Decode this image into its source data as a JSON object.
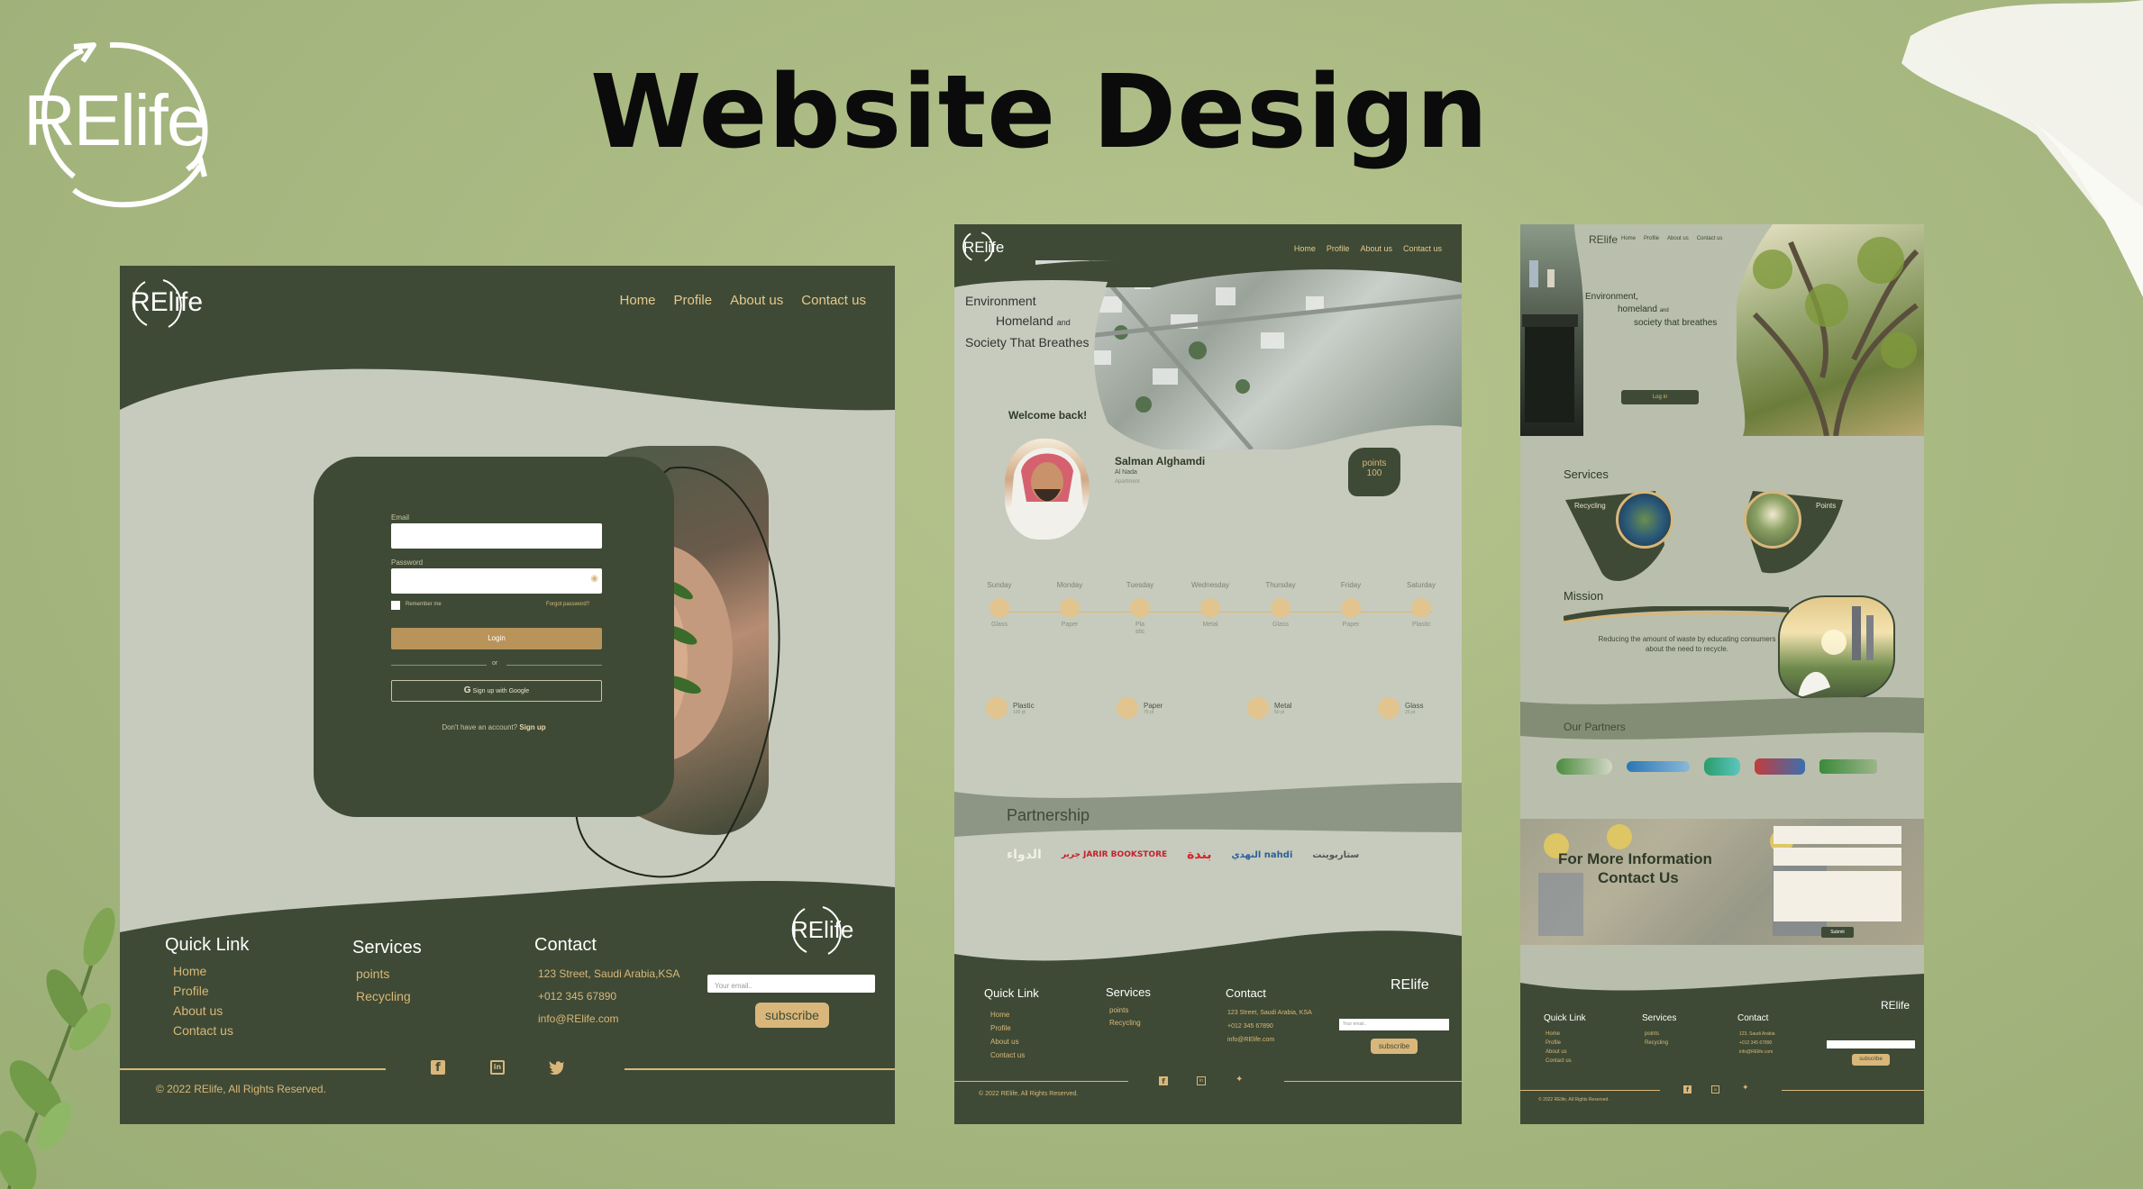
{
  "brand": {
    "logo_text": "RElife"
  },
  "headline": "Website Design",
  "login_page": {
    "logo": "RElife",
    "nav": [
      "Home",
      "Profile",
      "About us",
      "Contact us"
    ],
    "form": {
      "email_label": "Email",
      "password_label": "Password",
      "remember": "Remember me",
      "forgot": "Forgot password?",
      "login_button": "Login",
      "or": "or",
      "google_button": "Sign up with Google",
      "no_account": "Don't have an account?",
      "signup": "Sign up"
    },
    "footer": {
      "quick_link_title": "Quick Link",
      "quick_links": [
        "Home",
        "Profile",
        "About us",
        "Contact us"
      ],
      "services_title": "Services",
      "services": [
        "points",
        "Recycling"
      ],
      "contact_title": "Contact",
      "contact": [
        "123 Street, Saudi Arabia,KSA",
        "+012 345 67890",
        "info@RElife.com"
      ],
      "email_placeholder": "Your email..",
      "subscribe": "subscribe",
      "logo": "RElife",
      "copyright": "© 2022 RElife, All Rights Reserved."
    }
  },
  "profile_page": {
    "logo": "RElife",
    "nav": [
      "Home",
      "Profile",
      "About us",
      "Contact us"
    ],
    "hero_lines": [
      "Environment",
      "Homeland",
      "and",
      "Society That Breathes"
    ],
    "welcome": "Welcome back!",
    "user_name": "Salman Alghamdi",
    "user_sub1": "Al Nada",
    "user_sub2": "Apartment",
    "points_label": "points",
    "points_value": "100",
    "schedule": [
      {
        "day": "Sunday",
        "item": "Glass"
      },
      {
        "day": "Monday",
        "item": "Paper"
      },
      {
        "day": "Tuesday",
        "item": "Pla stic"
      },
      {
        "day": "Wednesday",
        "item": "Metal"
      },
      {
        "day": "Thursday",
        "item": "Glass"
      },
      {
        "day": "Friday",
        "item": "Paper"
      },
      {
        "day": "Saturday",
        "item": "Plastic"
      }
    ],
    "rates": [
      {
        "name": "Plastic",
        "value": "100 pt"
      },
      {
        "name": "Paper",
        "value": "75 pt"
      },
      {
        "name": "Metal",
        "value": "50 pt"
      },
      {
        "name": "Glass",
        "value": "25 pt"
      }
    ],
    "partnership_title": "Partnership",
    "partners": [
      "الدواء",
      "جرير JARIR BOOKSTORE",
      "بندة",
      "النهدي nahdi",
      "ستاربوينت"
    ],
    "footer": {
      "quick_link_title": "Quick Link",
      "quick_links": [
        "Home",
        "Profile",
        "About us",
        "Contact us"
      ],
      "services_title": "Services",
      "services": [
        "points",
        "Recycling"
      ],
      "contact_title": "Contact",
      "contact": [
        "123 Street, Saudi Arabia, KSA",
        "+012 345 67890",
        "info@RElife.com"
      ],
      "email_placeholder": "Your email..",
      "subscribe": "subscribe",
      "logo": "RElife",
      "copyright": "© 2022 RElife, All Rights Reserved."
    }
  },
  "home_page": {
    "logo": "RElife",
    "nav": [
      "Home",
      "Profile",
      "About us",
      "Contact us"
    ],
    "hero_lines": [
      "Environment,",
      "homeland",
      "and",
      "society that breathes"
    ],
    "login_button": "Log in",
    "services_title": "Services",
    "service_cards": [
      "Recycling",
      "Points"
    ],
    "mission_title": "Mission",
    "mission_text": "Reducing the amount of waste by educating consumers about the need to recycle.",
    "partners_title": "Our Partners",
    "contact_title_1": "For More Information",
    "contact_title_2": "Contact Us",
    "submit": "Submit",
    "footer": {
      "quick_link_title": "Quick Link",
      "quick_links": [
        "Home",
        "Profile",
        "About us",
        "Contact us"
      ],
      "services_title": "Services",
      "services": [
        "points",
        "Recycling"
      ],
      "contact_title": "Contact",
      "contact": [
        "123, Saudi Arabia",
        "+012 345 67890",
        "info@RElife.com"
      ],
      "subscribe": "subscribe",
      "logo": "RElife",
      "copyright": "© 2022 RElife, All Rights Reserved."
    }
  },
  "colors": {
    "dark_green": "#3e4a35",
    "gold": "#d9b77a",
    "light_sage": "#c5cabb",
    "background": "#a9b982"
  }
}
